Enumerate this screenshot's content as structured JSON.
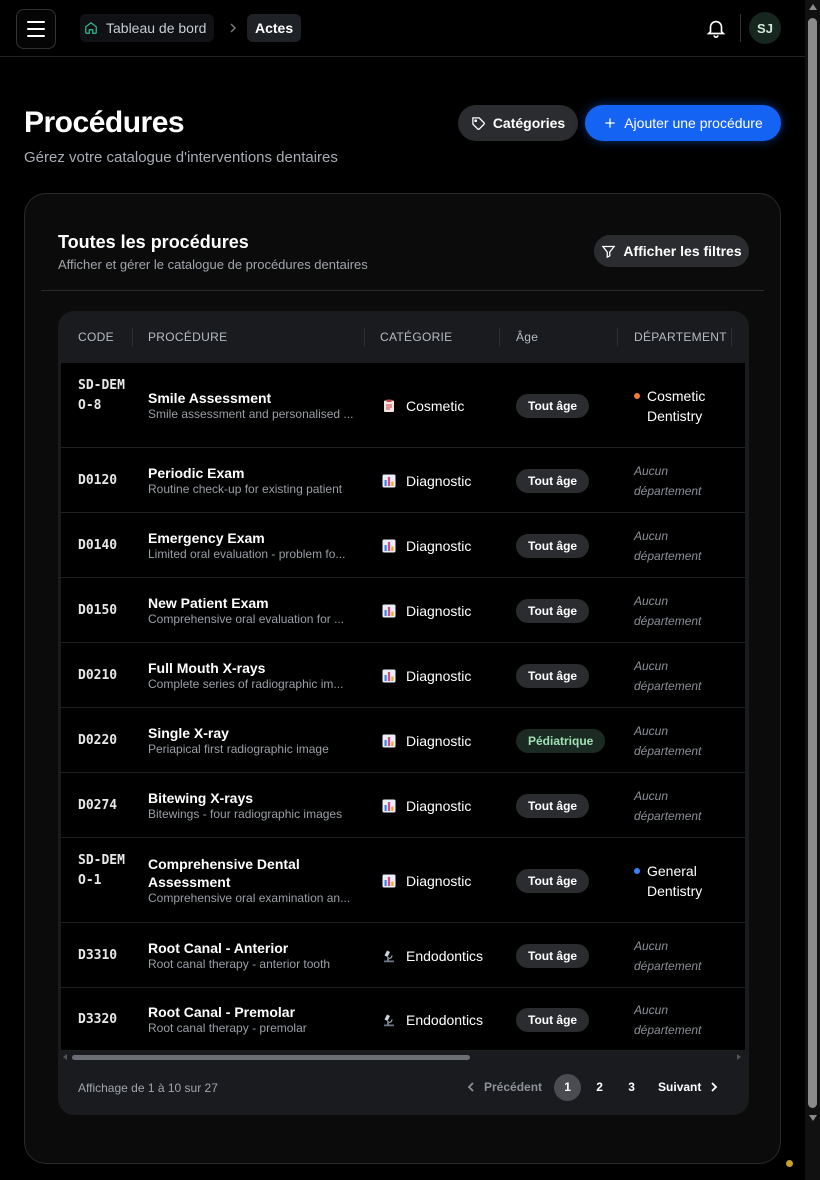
{
  "header": {
    "breadcrumb_home": "Tableau de bord",
    "breadcrumb_current": "Actes",
    "avatar_initials": "SJ"
  },
  "page": {
    "title": "Procédures",
    "subtitle": "Gérez votre catalogue d'interventions dentaires",
    "categories_button": "Catégories",
    "add_button": "Ajouter une procédure"
  },
  "card": {
    "title": "Toutes les procédures",
    "subtitle": "Afficher et gérer le catalogue de procédures dentaires",
    "filters_button": "Afficher les filtres"
  },
  "table": {
    "columns": [
      "CODE",
      "PROCÉDURE",
      "CATÉGORIE",
      "Âge",
      "DÉPARTEMENT"
    ],
    "rows": [
      {
        "code": "SD-DEMO-8",
        "name": "Smile Assessment",
        "desc": "Smile assessment and personalised ...",
        "category": "Cosmetic",
        "category_icon": "clipboard-icon",
        "age": "Tout âge",
        "department": "Cosmetic Dentistry",
        "dept_color": "#f07a3a"
      },
      {
        "code": "D0120",
        "name": "Periodic Exam",
        "desc": "Routine check-up for existing patient",
        "category": "Diagnostic",
        "category_icon": "bar-chart-icon",
        "age": "Tout âge",
        "department": "Aucun département",
        "dept_color": ""
      },
      {
        "code": "D0140",
        "name": "Emergency Exam",
        "desc": "Limited oral evaluation - problem fo...",
        "category": "Diagnostic",
        "category_icon": "bar-chart-icon",
        "age": "Tout âge",
        "department": "Aucun département",
        "dept_color": ""
      },
      {
        "code": "D0150",
        "name": "New Patient Exam",
        "desc": "Comprehensive oral evaluation for ...",
        "category": "Diagnostic",
        "category_icon": "bar-chart-icon",
        "age": "Tout âge",
        "department": "Aucun département",
        "dept_color": ""
      },
      {
        "code": "D0210",
        "name": "Full Mouth X-rays",
        "desc": "Complete series of radiographic im...",
        "category": "Diagnostic",
        "category_icon": "bar-chart-icon",
        "age": "Tout âge",
        "department": "Aucun département",
        "dept_color": ""
      },
      {
        "code": "D0220",
        "name": "Single X-ray",
        "desc": "Periapical first radiographic image",
        "category": "Diagnostic",
        "category_icon": "bar-chart-icon",
        "age": "Pédiatrique",
        "department": "Aucun département",
        "dept_color": ""
      },
      {
        "code": "D0274",
        "name": "Bitewing X-rays",
        "desc": "Bitewings - four radiographic images",
        "category": "Diagnostic",
        "category_icon": "bar-chart-icon",
        "age": "Tout âge",
        "department": "Aucun département",
        "dept_color": ""
      },
      {
        "code": "SD-DEMO-1",
        "name": "Comprehensive Dental Assessment",
        "desc": "Comprehensive oral examination an...",
        "category": "Diagnostic",
        "category_icon": "bar-chart-icon",
        "age": "Tout âge",
        "department": "General Dentistry",
        "dept_color": "#3b82f6"
      },
      {
        "code": "D3310",
        "name": "Root Canal - Anterior",
        "desc": "Root canal therapy - anterior tooth",
        "category": "Endodontics",
        "category_icon": "microscope-icon",
        "age": "Tout âge",
        "department": "Aucun département",
        "dept_color": ""
      },
      {
        "code": "D3320",
        "name": "Root Canal - Premolar",
        "desc": "Root canal therapy - premolar",
        "category": "Endodontics",
        "category_icon": "microscope-icon",
        "age": "Tout âge",
        "department": "Aucun département",
        "dept_color": ""
      }
    ]
  },
  "pagination": {
    "info": "Affichage de 1 à 10 sur 27",
    "prev": "Précédent",
    "next": "Suivant",
    "pages": [
      "1",
      "2",
      "3"
    ],
    "current": "1"
  }
}
